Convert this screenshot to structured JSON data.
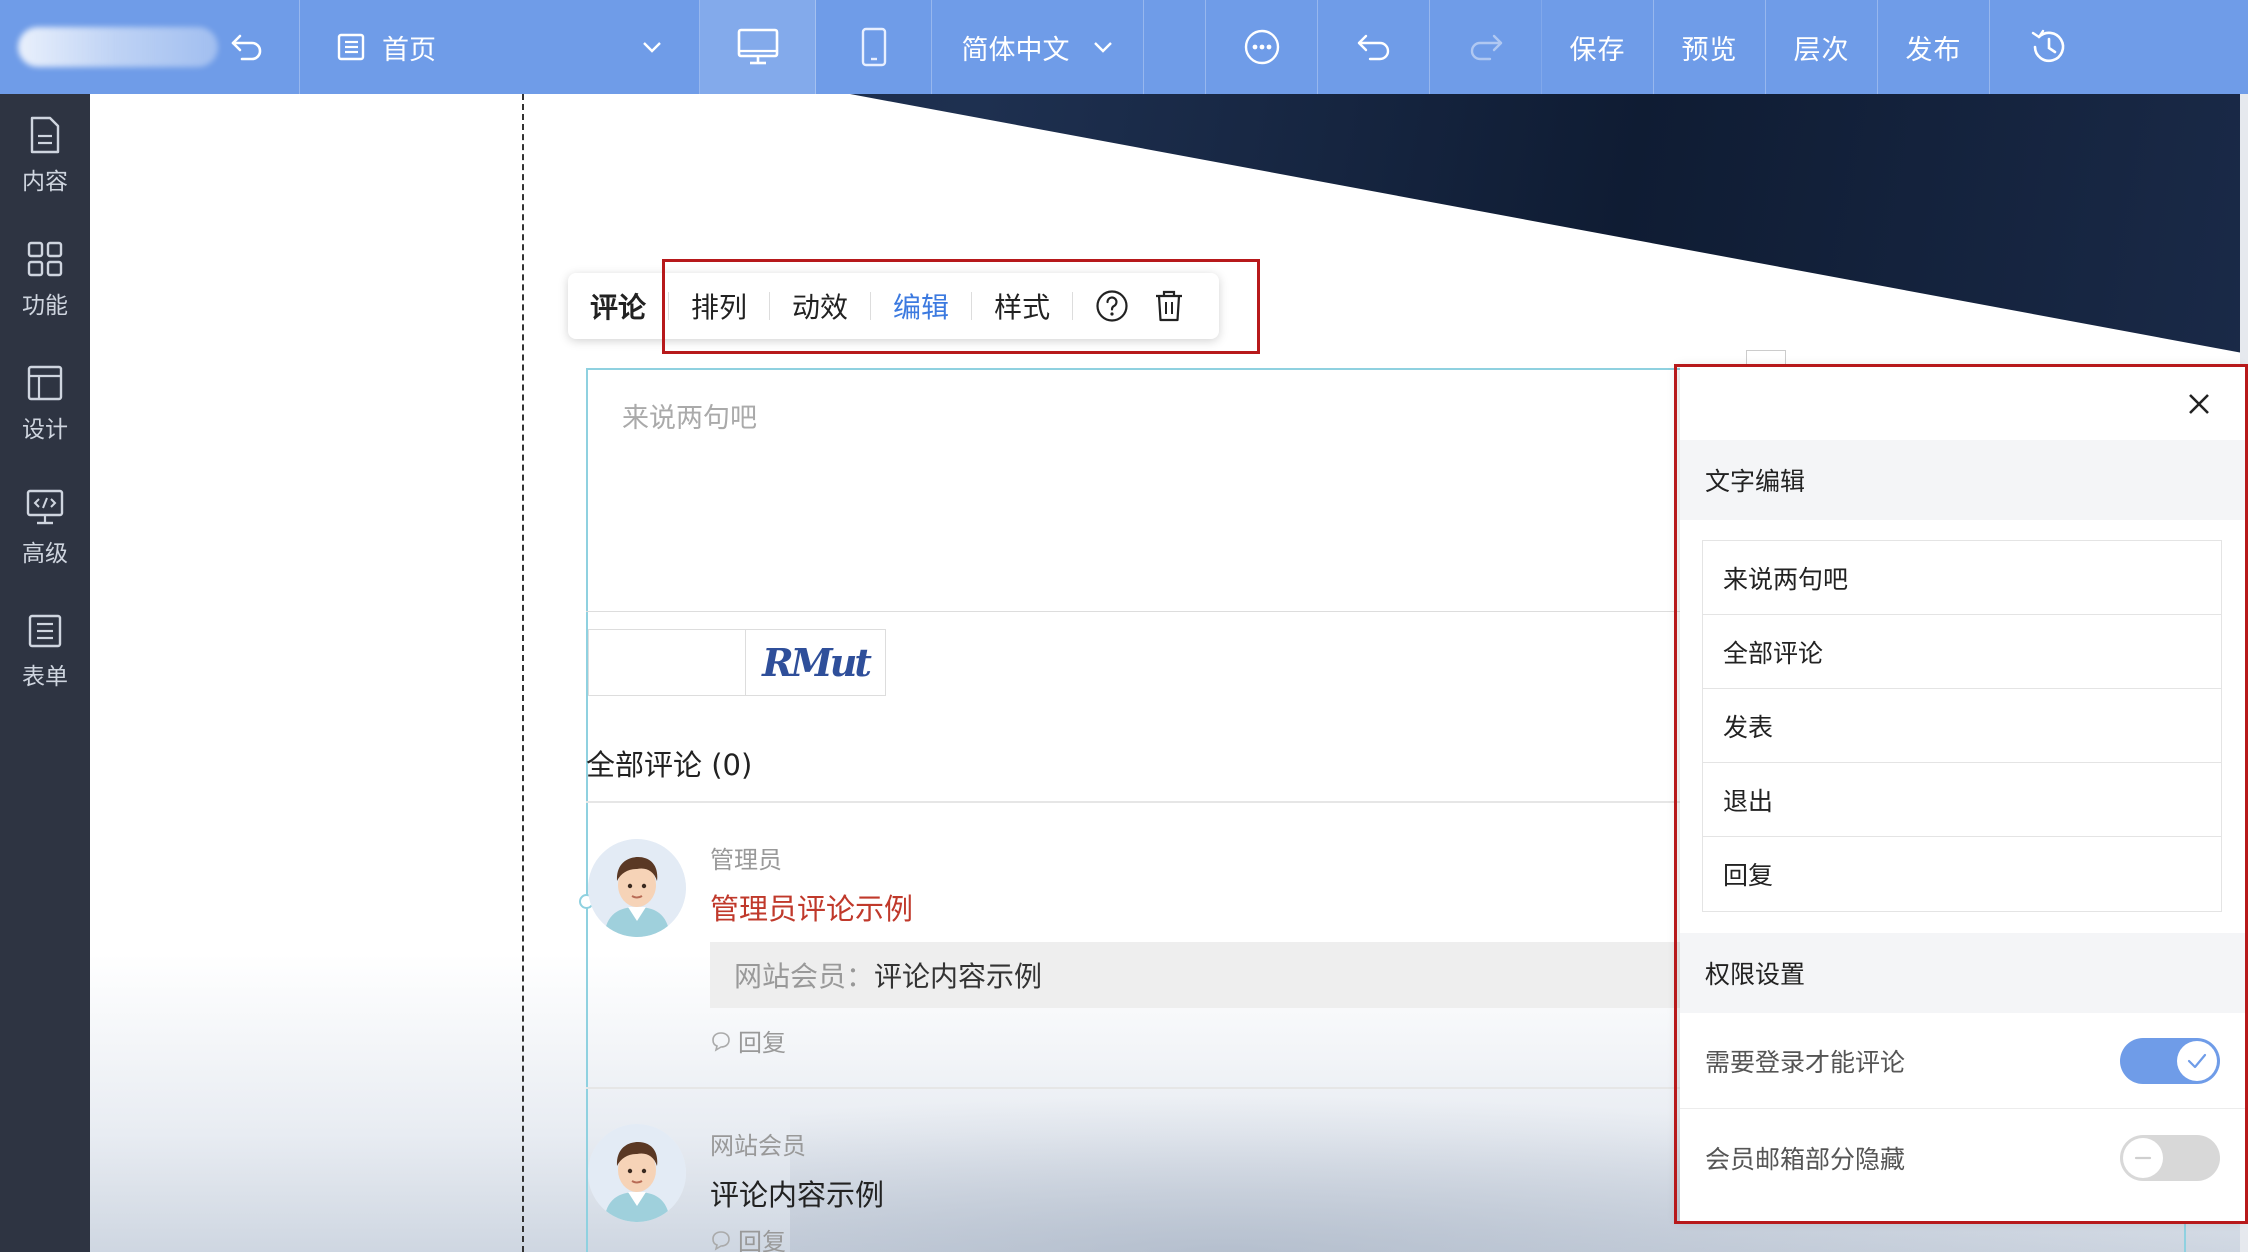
{
  "topbar": {
    "page_label": "首页",
    "language_label": "简体中文",
    "save_label": "保存",
    "preview_label": "预览",
    "layers_label": "层次",
    "publish_label": "发布"
  },
  "sidebar": {
    "items": [
      {
        "label": "内容",
        "icon": "file-icon"
      },
      {
        "label": "功能",
        "icon": "grid-icon"
      },
      {
        "label": "设计",
        "icon": "layout-icon"
      },
      {
        "label": "高级",
        "icon": "code-monitor-icon"
      },
      {
        "label": "表单",
        "icon": "list-icon"
      }
    ]
  },
  "module_toolbar": {
    "title": "评论",
    "buttons": [
      "排列",
      "动效",
      "编辑",
      "样式"
    ],
    "active": "编辑"
  },
  "comment": {
    "placeholder": "来说两句吧",
    "captcha_text": "RMut",
    "all_comments": "全部评论 (0)",
    "items": [
      {
        "author": "管理员",
        "content": "管理员评论示例",
        "quote_name": "网站会员：",
        "quote_text": "评论内容示例",
        "reply": "回复"
      },
      {
        "author": "网站会员",
        "content": "评论内容示例",
        "reply": "回复"
      }
    ]
  },
  "panel": {
    "text_section": "文字编辑",
    "text_items": [
      "来说两句吧",
      "全部评论",
      "发表",
      "退出",
      "回复"
    ],
    "perm_section": "权限设置",
    "perm_items": [
      {
        "label": "需要登录才能评论",
        "on": true
      },
      {
        "label": "会员邮箱部分隐藏",
        "on": false
      }
    ]
  },
  "colors": {
    "topbar": "#6f9ce8",
    "sidebar": "#2e3442",
    "accent": "#3c7ae0",
    "highlight": "#b7191b",
    "admin_comment": "#c0392b"
  }
}
